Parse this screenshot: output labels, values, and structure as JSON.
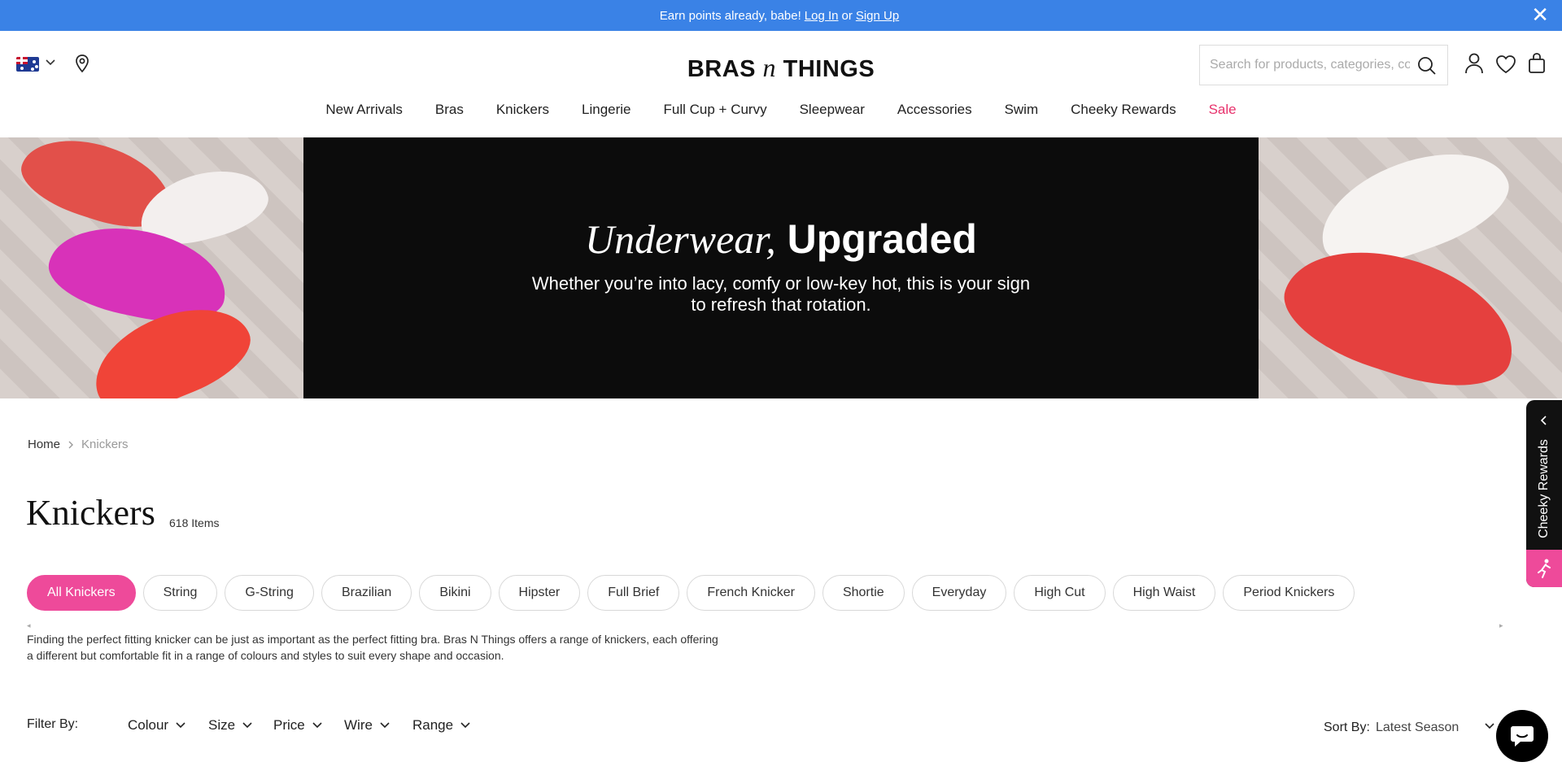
{
  "announcement": {
    "text": "Earn points already, babe!",
    "login": "Log In",
    "or": "or",
    "signup": "Sign Up",
    "close": "✕"
  },
  "header": {
    "logo_left": "BRAS",
    "logo_mid": "n",
    "logo_right": "THINGS",
    "search_placeholder": "Search for products, categories, collections"
  },
  "nav": [
    {
      "label": "New Arrivals"
    },
    {
      "label": "Bras"
    },
    {
      "label": "Knickers"
    },
    {
      "label": "Lingerie"
    },
    {
      "label": "Full Cup + Curvy"
    },
    {
      "label": "Sleepwear"
    },
    {
      "label": "Accessories"
    },
    {
      "label": "Swim"
    },
    {
      "label": "Cheeky Rewards"
    },
    {
      "label": "Sale"
    }
  ],
  "hero": {
    "title_italic": "Underwear,",
    "title_bold": "Upgraded",
    "subtitle": "Whether you’re into lacy, comfy or low-key hot, this is your sign to refresh that rotation."
  },
  "breadcrumb": {
    "home": "Home",
    "current": "Knickers"
  },
  "page": {
    "title": "Knickers",
    "count": "618 Items",
    "description": "Finding the perfect fitting knicker can be just as important as the perfect fitting bra. Bras N Things offers a range of knickers, each offering a different but comfortable fit in a range of colours and styles to suit every shape and occasion."
  },
  "chips": [
    {
      "label": "All Knickers"
    },
    {
      "label": "String"
    },
    {
      "label": "G-String"
    },
    {
      "label": "Brazilian"
    },
    {
      "label": "Bikini"
    },
    {
      "label": "Hipster"
    },
    {
      "label": "Full Brief"
    },
    {
      "label": "French Knicker"
    },
    {
      "label": "Shortie"
    },
    {
      "label": "Everyday"
    },
    {
      "label": "High Cut"
    },
    {
      "label": "High Waist"
    },
    {
      "label": "Period Knickers"
    }
  ],
  "filters": {
    "label": "Filter By:",
    "items": [
      {
        "label": "Colour"
      },
      {
        "label": "Size"
      },
      {
        "label": "Price"
      },
      {
        "label": "Wire"
      },
      {
        "label": "Range"
      }
    ],
    "sort_label": "Sort By:",
    "sort_value": "Latest Season"
  },
  "rewards_tab": {
    "label": "Cheeky Rewards"
  },
  "colors": {
    "announcement_bg": "#3a82e6",
    "accent_pink": "#ee4a9a",
    "sale_red": "#e8336d"
  }
}
